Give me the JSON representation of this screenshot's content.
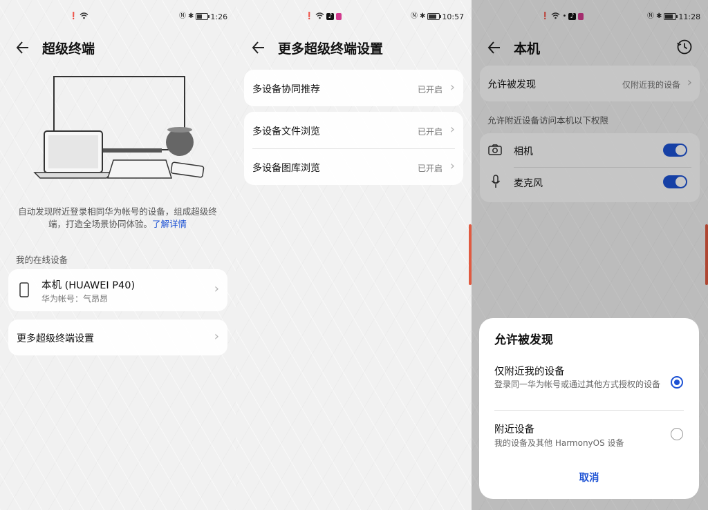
{
  "accent_color": "#1d52d4",
  "panel1": {
    "status": {
      "time": "1:26"
    },
    "title": "超级终端",
    "description": "自动发现附近登录相同华为帐号的设备，组成超级终端，打造全场景协同体验。",
    "learn_more": "了解详情",
    "section_online": "我的在线设备",
    "device": {
      "name": "本机 (HUAWEI P40)",
      "account": "华为帐号：气昂昂"
    },
    "more_settings": "更多超级终端设置"
  },
  "panel2": {
    "status": {
      "time": "10:57"
    },
    "title": "更多超级终端设置",
    "items": [
      {
        "label": "多设备协同推荐",
        "value": "已开启"
      },
      {
        "label": "多设备文件浏览",
        "value": "已开启"
      },
      {
        "label": "多设备图库浏览",
        "value": "已开启"
      }
    ]
  },
  "panel3": {
    "status": {
      "time": "11:28"
    },
    "title": "本机",
    "discover": {
      "label": "允许被发现",
      "value": "仅附近我的设备"
    },
    "perm_header": "允许附近设备访问本机以下权限",
    "permissions": [
      {
        "label": "相机",
        "icon": "camera-icon",
        "on": true
      },
      {
        "label": "麦克风",
        "icon": "microphone-icon",
        "on": true
      }
    ],
    "dialog": {
      "title": "允许被发现",
      "options": [
        {
          "title": "仅附近我的设备",
          "desc": "登录同一华为帐号或通过其他方式授权的设备",
          "selected": true
        },
        {
          "title": "附近设备",
          "desc": "我的设备及其他 HarmonyOS 设备",
          "selected": false
        }
      ],
      "cancel": "取消"
    }
  }
}
